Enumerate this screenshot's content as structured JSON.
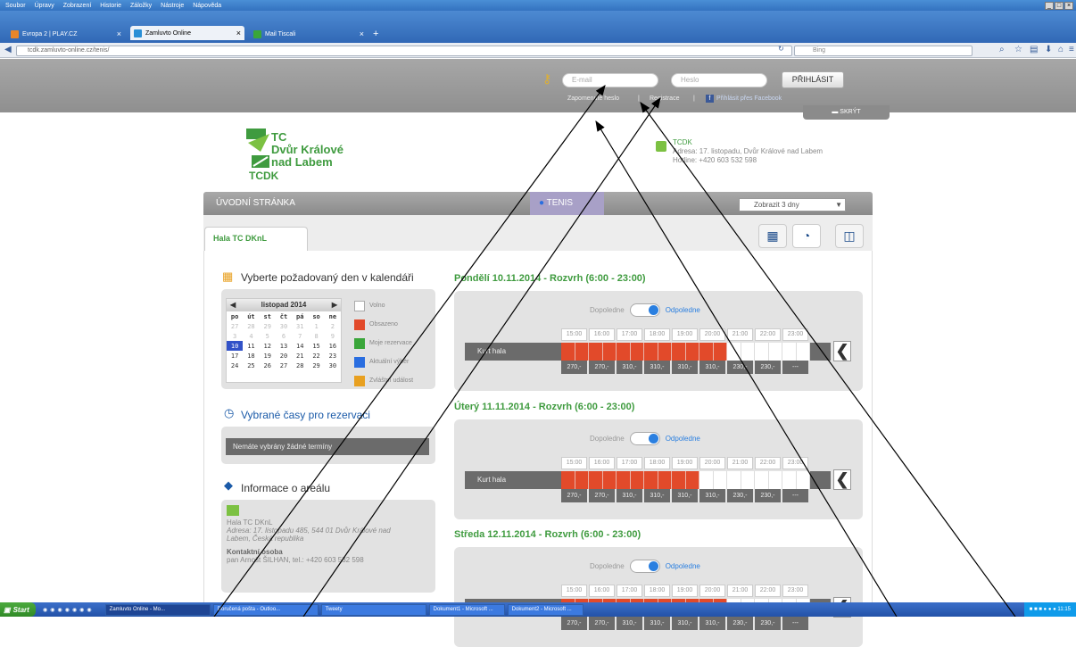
{
  "browser": {
    "menu": [
      "Soubor",
      "Úpravy",
      "Zobrazení",
      "Historie",
      "Záložky",
      "Nástroje",
      "Nápověda"
    ],
    "tabs": [
      {
        "label": "Evropa 2 | PLAY.CZ",
        "color": "#e8862a"
      },
      {
        "label": "Zamluvto Online",
        "color": "#2a8fd6"
      },
      {
        "label": "Mail Tiscali",
        "color": "#3aa63a"
      }
    ],
    "new_tab": "+",
    "url": "tcdk.zamluvto-online.cz/tenis/",
    "search_placeholder": "Bing"
  },
  "login": {
    "email_placeholder": "E-mail",
    "password_placeholder": "Heslo",
    "submit": "PŘIHLÁSIT",
    "forgot": "Zapomenuté heslo",
    "separator": "|",
    "register": "Registrace",
    "facebook": "Přihlásit přes Facebook",
    "hide": "SKRÝT"
  },
  "logo": {
    "line1": "TC",
    "line2": "Dvůr Králové",
    "line3": "nad Labem",
    "abbr": "TCDK"
  },
  "contact": {
    "title": "TCDK",
    "address": "Adresa: 17. listopadu, Dvůr Králové nad Labem",
    "hotline": "Hotline: +420 603 532 598"
  },
  "nav": {
    "home": "ÚVODNÍ STRÁNKA",
    "tenis": "TENIS",
    "show": "Zobrazit 3 dny"
  },
  "hall_tab": "Hala TC DKnL",
  "sidebar": {
    "choose_day": "Vyberte požadovaný den v kalendáři",
    "calendar": {
      "month": "listopad 2014",
      "days": [
        "po",
        "út",
        "st",
        "čt",
        "pá",
        "so",
        "ne"
      ],
      "weeks": [
        [
          "27",
          "28",
          "29",
          "30",
          "31",
          "1",
          "2"
        ],
        [
          "3",
          "4",
          "5",
          "6",
          "7",
          "8",
          "9"
        ],
        [
          "10",
          "11",
          "12",
          "13",
          "14",
          "15",
          "16"
        ],
        [
          "17",
          "18",
          "19",
          "20",
          "21",
          "22",
          "23"
        ],
        [
          "24",
          "25",
          "26",
          "27",
          "28",
          "29",
          "30"
        ]
      ]
    },
    "legend": [
      {
        "label": "Volno",
        "color": "#ffffff"
      },
      {
        "label": "Obsazeno",
        "color": "#e24a2a"
      },
      {
        "label": "Moje rezervace",
        "color": "#3aa63a"
      },
      {
        "label": "Aktuální výběr",
        "color": "#2a6ee0"
      },
      {
        "label": "Zvláštní událost",
        "color": "#e8a020"
      }
    ],
    "selected_times": "Vybrané časy pro rezervaci",
    "no_selection": "Nemáte vybrány žádné termíny",
    "info_title": "Informace o areálu",
    "info_name": "Hala TC DKnL",
    "info_address": "Adresa: 17. listopadu 485, 544 01 Dvůr Králové nad Labem, Česká republika",
    "contact_person_title": "Kontaktní osoba",
    "contact_person": "pan Arnošt ŠILHAN, tel.: +420 603 532 598"
  },
  "schedule": {
    "morning": "Dopoledne",
    "afternoon": "Odpoledne",
    "court": "Kurt hala",
    "hours": [
      "15:00",
      "16:00",
      "17:00",
      "18:00",
      "19:00",
      "20:00",
      "21:00",
      "22:00",
      "23:00"
    ],
    "prices": [
      "270,-",
      "270,-",
      "310,-",
      "310,-",
      "310,-",
      "310,-",
      "230,-",
      "230,-",
      "---"
    ],
    "days": [
      {
        "title": "Pondělí 10.11.2014 - Rozvrh (6:00 - 23:00)",
        "booked_slots": 12
      },
      {
        "title": "Úterý 11.11.2014 - Rozvrh (6:00 - 23:00)",
        "booked_slots": 10
      },
      {
        "title": "Středa 12.11.2014 - Rozvrh (6:00 - 23:00)",
        "booked_slots": 12
      }
    ]
  },
  "taskbar": {
    "start": "Start",
    "items": [
      "Zamluvto Online - Mo...",
      "Doručená pošta - Outloo...",
      "Tweety",
      "Dokument1 - Microsoft ...",
      "Dokument2 - Microsoft ..."
    ],
    "clock": "11:15"
  }
}
